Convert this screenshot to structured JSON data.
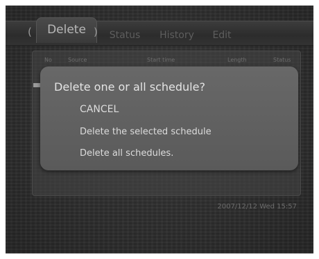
{
  "tabs": [
    {
      "label": "Delete"
    },
    {
      "label": "Status"
    },
    {
      "label": "History"
    },
    {
      "label": "Edit"
    }
  ],
  "table": {
    "headers": [
      "No",
      "Source",
      "Start time",
      "Length",
      "Status"
    ]
  },
  "dialog": {
    "title": "Delete one or all schedule?",
    "options": [
      "CANCEL",
      "Delete the selected schedule",
      "Delete all schedules."
    ]
  },
  "footer": {
    "datetime": "2007/12/12 Wed 15:57"
  }
}
